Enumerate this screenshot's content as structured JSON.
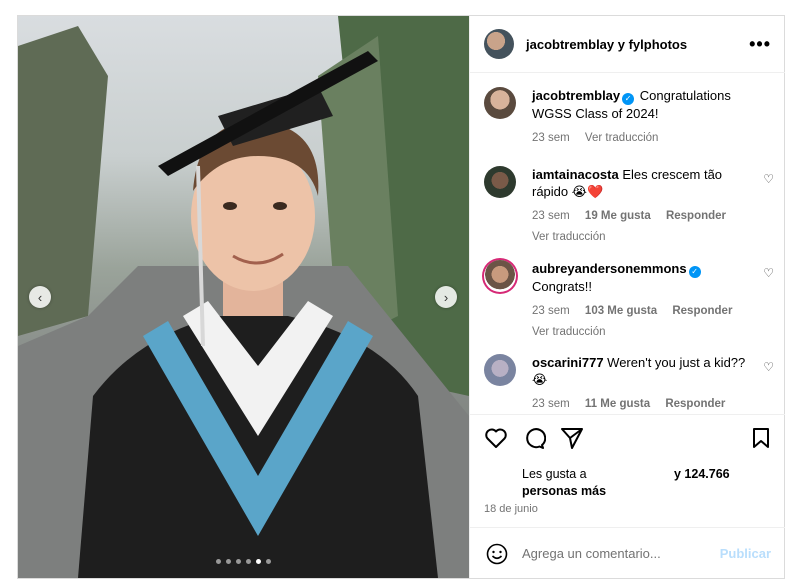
{
  "post": {
    "header": {
      "title": "jacobtremblay y fylphotos",
      "more_icon": "more-dots-icon"
    },
    "carousel": {
      "slide_count": 6,
      "active_index": 4
    },
    "caption": {
      "user": "jacobtremblay",
      "text": "Congratulations WGSS Class of 2024!",
      "time": "23 sem",
      "translate": "Ver traducción"
    },
    "comments": [
      {
        "user": "iamtainacosta",
        "text": "Eles crescem tão rápido 😭❤️",
        "time": "23 sem",
        "likes": "19 Me gusta",
        "reply": "Responder",
        "translate": "Ver traducción",
        "verified": false
      },
      {
        "user": "aubreyandersonemmons",
        "text": "Congrats!!",
        "time": "23 sem",
        "likes": "103 Me gusta",
        "reply": "Responder",
        "translate": "Ver traducción",
        "verified": true
      },
      {
        "user": "oscarini777",
        "text": "Weren't you just a kid?? 😭",
        "time": "23 sem",
        "likes": "11 Me gusta",
        "reply": "Responder",
        "verified": false
      }
    ],
    "likes_text_left": "Les gusta a",
    "likes_text_bold": "personas más",
    "likes_text_right": "y 124.766",
    "date": "18 de junio",
    "add_comment": {
      "placeholder": "Agrega un comentario...",
      "publish": "Publicar"
    },
    "colors": {
      "accent": "#0095f6",
      "heart": "#e0245e",
      "gown_stripe": "#5aa5c9"
    }
  }
}
